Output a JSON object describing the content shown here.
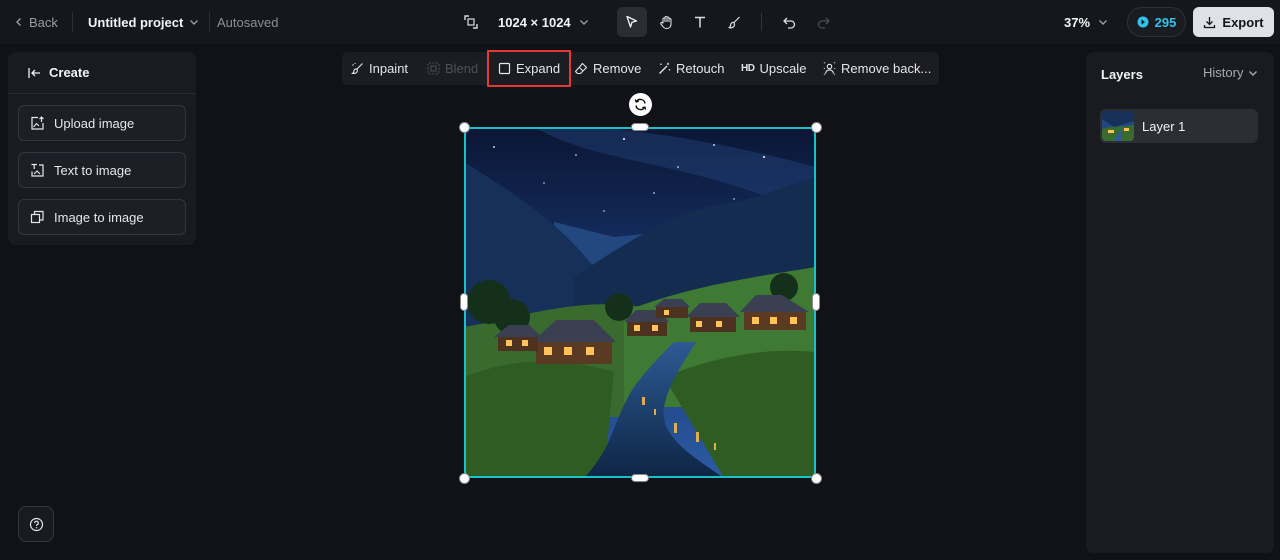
{
  "topbar": {
    "back_label": "Back",
    "project_title": "Untitled project",
    "autosave_status": "Autosaved",
    "canvas_size": "1024 × 1024",
    "zoom": "37%",
    "credits": "295",
    "export_label": "Export",
    "tools": [
      "select-tool",
      "hand-tool",
      "text-tool",
      "brush-tool",
      "undo",
      "redo"
    ]
  },
  "left_panel": {
    "header": "Create",
    "buttons": [
      {
        "label": "Upload image",
        "icon": "upload-image-icon"
      },
      {
        "label": "Text to image",
        "icon": "text-to-image-icon"
      },
      {
        "label": "Image to image",
        "icon": "image-to-image-icon"
      }
    ]
  },
  "edit_toolbar": {
    "inpaint": "Inpaint",
    "blend": "Blend",
    "expand": "Expand",
    "remove": "Remove",
    "retouch": "Retouch",
    "upscale_badge": "HD",
    "upscale": "Upscale",
    "remove_background": "Remove back..."
  },
  "right_panel": {
    "title": "Layers",
    "history_label": "History",
    "layers": [
      {
        "name": "Layer 1"
      }
    ]
  },
  "colors": {
    "selection": "#19c2c9",
    "highlight": "#e53935",
    "credits": "#35c0ea"
  }
}
